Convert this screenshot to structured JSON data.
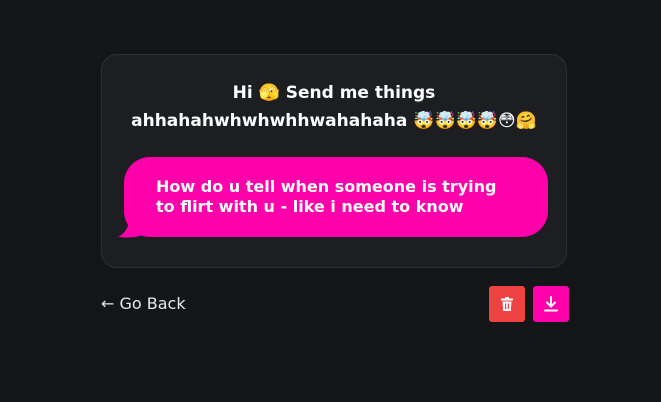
{
  "card": {
    "prompt_line1": "Hi 🫣 Send me things",
    "prompt_line2": "ahhahahwhwhwhhwahahaha 🤯🤯🤯🤯😳🤗"
  },
  "message": {
    "text": "How do u tell when someone is trying to flirt with u - like i need to know"
  },
  "nav": {
    "back_label": "← Go Back"
  },
  "actions": {
    "delete_icon": "trash-icon",
    "download_icon": "download-icon"
  },
  "colors": {
    "background": "#141517",
    "card": "#1d1e21",
    "bubble": "#ff00aa",
    "delete": "#ef4343",
    "download": "#ff00aa"
  }
}
